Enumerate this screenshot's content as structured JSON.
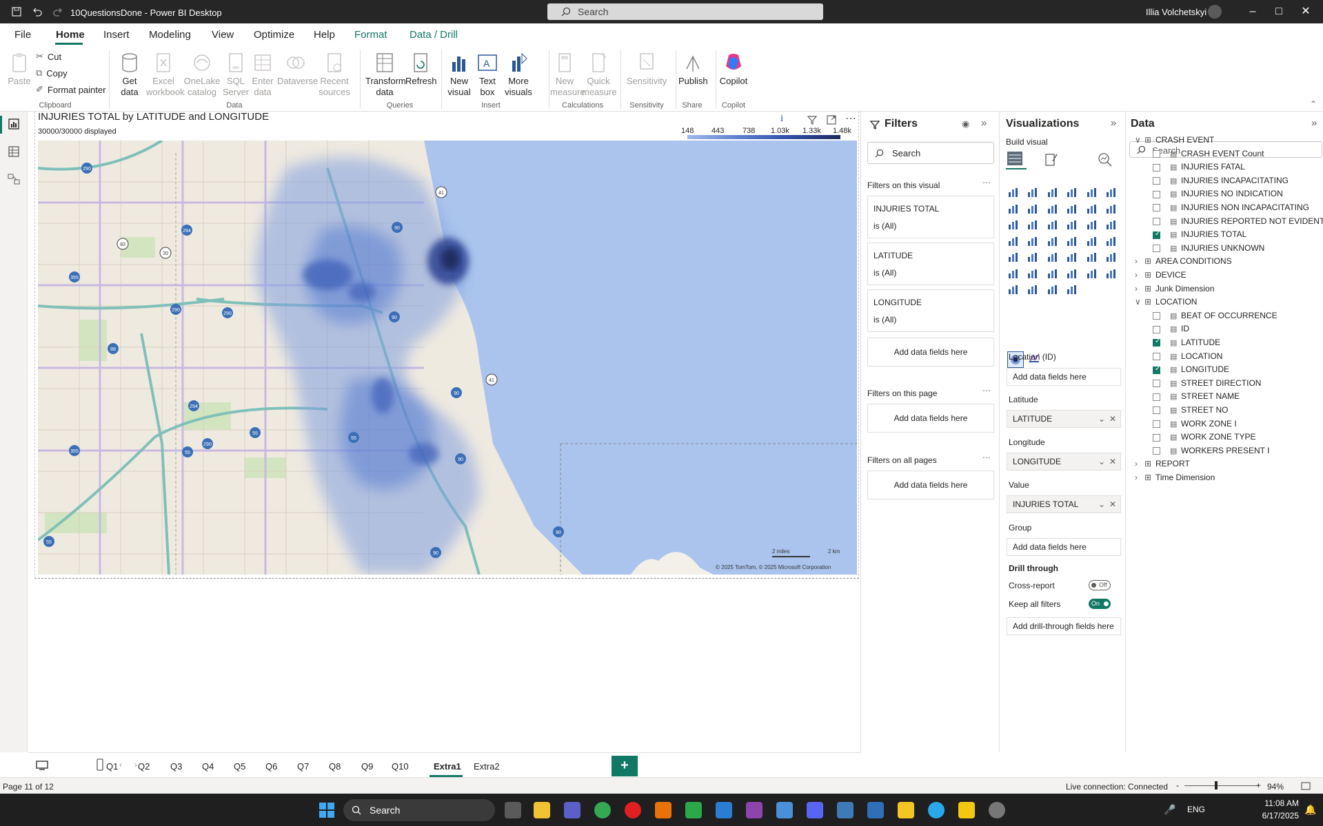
{
  "window": {
    "file_title": "10QuestionsDone - Power BI Desktop",
    "search_placeholder": "Search",
    "user_name": "Illia Volchetskyi"
  },
  "menu": {
    "items": [
      "File",
      "Home",
      "Insert",
      "Modeling",
      "View",
      "Optimize",
      "Help",
      "Format",
      "Data / Drill"
    ],
    "active": "Home"
  },
  "ribbon": {
    "clipboard": {
      "paste": "Paste",
      "cut": "Cut",
      "copy": "Copy",
      "format_painter": "Format painter",
      "label": "Clipboard"
    },
    "data": {
      "get_data": "Get data",
      "excel": "Excel workbook",
      "onelake": "OneLake catalog",
      "sql": "SQL Server",
      "enter": "Enter data",
      "dataverse": "Dataverse",
      "recent": "Recent sources",
      "label": "Data"
    },
    "queries": {
      "transform": "Transform data",
      "refresh": "Refresh",
      "label": "Queries"
    },
    "insert": {
      "new_visual": "New visual",
      "text_box": "Text box",
      "more_visuals": "More visuals",
      "label": "Insert"
    },
    "calculations": {
      "new_measure": "New measure",
      "quick_measure": "Quick measure",
      "label": "Calculations"
    },
    "sensitivity": {
      "sensitivity": "Sensitivity",
      "label": "Sensitivity"
    },
    "share": {
      "publish": "Publish",
      "label": "Share"
    },
    "copilot": {
      "copilot": "Copilot",
      "label": "Copilot"
    }
  },
  "visual": {
    "title": "INJURIES TOTAL by LATITUDE and LONGITUDE",
    "subtitle": "30000/30000 displayed",
    "legend_ticks": [
      "148",
      "443",
      "738",
      "1.03k",
      "1.33k",
      "1.48k"
    ],
    "attribution": "© 2025 TomTom, © 2025 Microsoft Corporation",
    "scale_miles": "2 miles",
    "scale_km": "2 km",
    "info_icon": "i"
  },
  "filters": {
    "title": "Filters",
    "search_placeholder": "Search",
    "on_visual": "Filters on this visual",
    "cards": [
      {
        "field": "INJURIES TOTAL",
        "value": "is (All)"
      },
      {
        "field": "LATITUDE",
        "value": "is (All)"
      },
      {
        "field": "LONGITUDE",
        "value": "is (All)"
      }
    ],
    "add_here": "Add data fields here",
    "on_page": "Filters on this page",
    "on_all": "Filters on all pages"
  },
  "visualizations": {
    "title": "Visualizations",
    "build_visual": "Build visual",
    "wells": {
      "location_label": "Location (ID)",
      "location_placeholder": "Add data fields here",
      "latitude_label": "Latitude",
      "latitude_value": "LATITUDE",
      "longitude_label": "Longitude",
      "longitude_value": "LONGITUDE",
      "value_label": "Value",
      "value_value": "INJURIES TOTAL",
      "group_label": "Group",
      "group_placeholder": "Add data fields here"
    },
    "drill": {
      "title": "Drill through",
      "cross_report": "Cross-report",
      "cross_state": "Off",
      "keep_filters": "Keep all filters",
      "keep_state": "On",
      "placeholder": "Add drill-through fields here"
    }
  },
  "data_pane": {
    "title": "Data",
    "search_placeholder": "Search",
    "tables": [
      {
        "name": "CRASH EVENT",
        "expanded": true,
        "fields": [
          {
            "name": "CRASH EVENT Count",
            "checked": false
          },
          {
            "name": "INJURIES FATAL",
            "checked": false
          },
          {
            "name": "INJURIES INCAPACITATING",
            "checked": false
          },
          {
            "name": "INJURIES NO INDICATION",
            "checked": false
          },
          {
            "name": "INJURIES NON INCAPACITATING",
            "checked": false
          },
          {
            "name": "INJURIES REPORTED NOT EVIDENT",
            "checked": false
          },
          {
            "name": "INJURIES TOTAL",
            "checked": true
          },
          {
            "name": "INJURIES UNKNOWN",
            "checked": false
          }
        ]
      },
      {
        "name": "AREA CONDITIONS",
        "expanded": false,
        "fields": []
      },
      {
        "name": "DEVICE",
        "expanded": false,
        "fields": []
      },
      {
        "name": "Junk Dimension",
        "expanded": false,
        "fields": []
      },
      {
        "name": "LOCATION",
        "expanded": true,
        "fields": [
          {
            "name": "BEAT OF OCCURRENCE",
            "checked": false
          },
          {
            "name": "ID",
            "checked": false
          },
          {
            "name": "LATITUDE",
            "checked": true
          },
          {
            "name": "LOCATION",
            "checked": false
          },
          {
            "name": "LONGITUDE",
            "checked": true
          },
          {
            "name": "STREET DIRECTION",
            "checked": false
          },
          {
            "name": "STREET NAME",
            "checked": false
          },
          {
            "name": "STREET NO",
            "checked": false
          },
          {
            "name": "WORK ZONE I",
            "checked": false
          },
          {
            "name": "WORK ZONE TYPE",
            "checked": false
          },
          {
            "name": "WORKERS PRESENT I",
            "checked": false
          }
        ]
      },
      {
        "name": "REPORT",
        "expanded": false,
        "fields": []
      },
      {
        "name": "Time Dimension",
        "expanded": false,
        "fields": []
      }
    ]
  },
  "pages": {
    "tabs": [
      "Q1",
      "Q2",
      "Q3",
      "Q4",
      "Q5",
      "Q6",
      "Q7",
      "Q8",
      "Q9",
      "Q10",
      "Extra1",
      "Extra2"
    ],
    "active": "Extra1",
    "add": "+"
  },
  "status": {
    "page": "Page 11 of 12",
    "connection": "Live connection: Connected",
    "zoom": "94%",
    "zoom_minus": "-",
    "zoom_plus": "+"
  },
  "taskbar": {
    "search": "Search",
    "lang": "ENG",
    "time": "11:08 AM",
    "date": "6/17/2025"
  },
  "colors": {
    "accent": "#117865",
    "heat_light": "#a9c3ec",
    "heat_dark": "#1f2a5c",
    "water": "#aac4ed"
  }
}
